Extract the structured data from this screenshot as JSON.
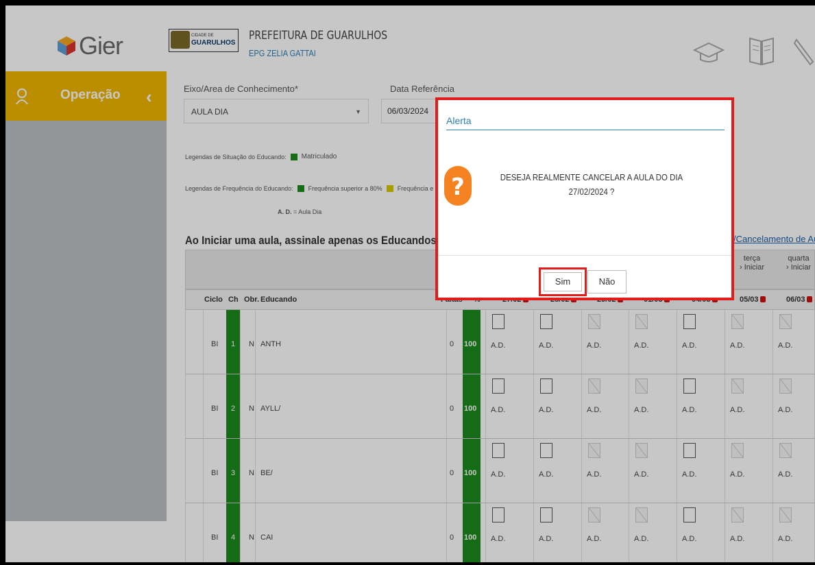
{
  "header": {
    "logo_text": "Gier",
    "crest_small": "CIDADE DE",
    "crest_name": "GUARULHOS",
    "prefeitura": "PREFEITURA DE GUARULHOS",
    "escola": "EPG ZELIA GATTAI"
  },
  "sidebar": {
    "menu_label": "Operação",
    "collapse_glyph": "‹"
  },
  "form": {
    "eixo_label": "Eixo/Area de Conhecimento*",
    "eixo_value": "AULA DIA",
    "data_label": "Data Referência",
    "data_value": "06/03/2024"
  },
  "legend": {
    "situacao_label": "Legendas de Situação do Educando:",
    "matriculado": "Matriculado",
    "frequencia_label": "Legendas de Frequência do Educando:",
    "freq_sup80": "Frequência superior a 80%",
    "freq_other": "Frequência e",
    "ad_bold": "A. D.",
    "ad_desc": "= Aula Dia"
  },
  "colors": {
    "green": "#1d8b1d",
    "yellow": "#d8c800",
    "accent": "#f0b700",
    "alert_red": "#e21b1b"
  },
  "instruction": "Ao Iniciar uma aula, assinale apenas os Educandos Au",
  "cancel_link": "/Cancelamento de Au",
  "table": {
    "col_ciclo": "Ciclo",
    "col_ch": "Ch",
    "col_obr": "Obr.",
    "col_educando": "Educando",
    "col_faltas": "Faltas",
    "col_pct": "%",
    "days": [
      {
        "date": "27/02",
        "weekday": "",
        "action": ""
      },
      {
        "date": "28/02",
        "weekday": "",
        "action": ""
      },
      {
        "date": "29/02",
        "weekday": "",
        "action": ""
      },
      {
        "date": "01/03",
        "weekday": "",
        "action": ""
      },
      {
        "date": "04/03",
        "weekday": "",
        "action": ""
      },
      {
        "date": "05/03",
        "weekday": "terça",
        "action": "Iniciar"
      },
      {
        "date": "06/03",
        "weekday": "quarta",
        "action": "Iniciar"
      }
    ],
    "ad_label": "A.D.",
    "rows": [
      {
        "ciclo": "BI",
        "ch": "1",
        "obr": "N",
        "educando": "ANTH",
        "faltas": "0",
        "pct": "100"
      },
      {
        "ciclo": "BI",
        "ch": "2",
        "obr": "N",
        "educando": "AYLL/",
        "faltas": "0",
        "pct": "100"
      },
      {
        "ciclo": "BI",
        "ch": "3",
        "obr": "N",
        "educando": "BE/",
        "faltas": "0",
        "pct": "100"
      },
      {
        "ciclo": "BI",
        "ch": "4",
        "obr": "N",
        "educando": "CAI",
        "faltas": "0",
        "pct": "100"
      }
    ]
  },
  "modal": {
    "title": "Alerta",
    "message_line1": "DESEJA REALMENTE CANCELAR A AULA DO DIA",
    "message_line2": "27/02/2024 ?",
    "yes_label": "Sim",
    "no_label": "Não"
  }
}
